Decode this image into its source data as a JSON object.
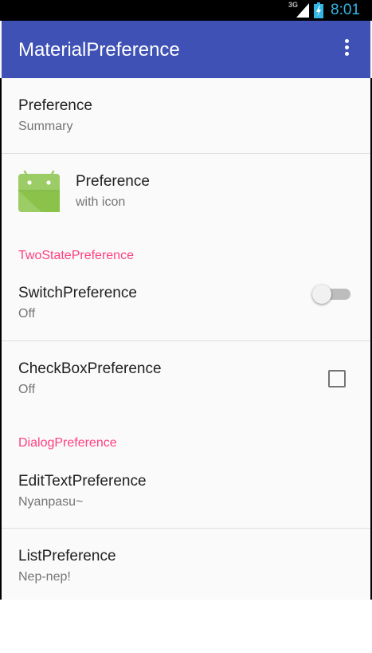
{
  "status_bar": {
    "network": "3G",
    "time": "8:01"
  },
  "app_bar": {
    "title": "MaterialPreference",
    "overflow_icon": "more-vert-icon"
  },
  "preferences": {
    "basic": {
      "title": "Preference",
      "summary": "Summary"
    },
    "with_icon": {
      "title": "Preference",
      "summary": "with icon",
      "icon": "android-icon"
    },
    "two_state_category": "TwoStatePreference",
    "switch_pref": {
      "title": "SwitchPreference",
      "summary": "Off",
      "checked": false
    },
    "checkbox_pref": {
      "title": "CheckBoxPreference",
      "summary": "Off",
      "checked": false
    },
    "dialog_category": "DialogPreference",
    "edit_text_pref": {
      "title": "EditTextPreference",
      "summary": "Nyanpasu~"
    },
    "list_pref": {
      "title": "ListPreference",
      "summary": "Nep-nep!"
    }
  },
  "colors": {
    "primary": "#3f51b5",
    "accent": "#ff4081",
    "status_time": "#33b5e5"
  }
}
